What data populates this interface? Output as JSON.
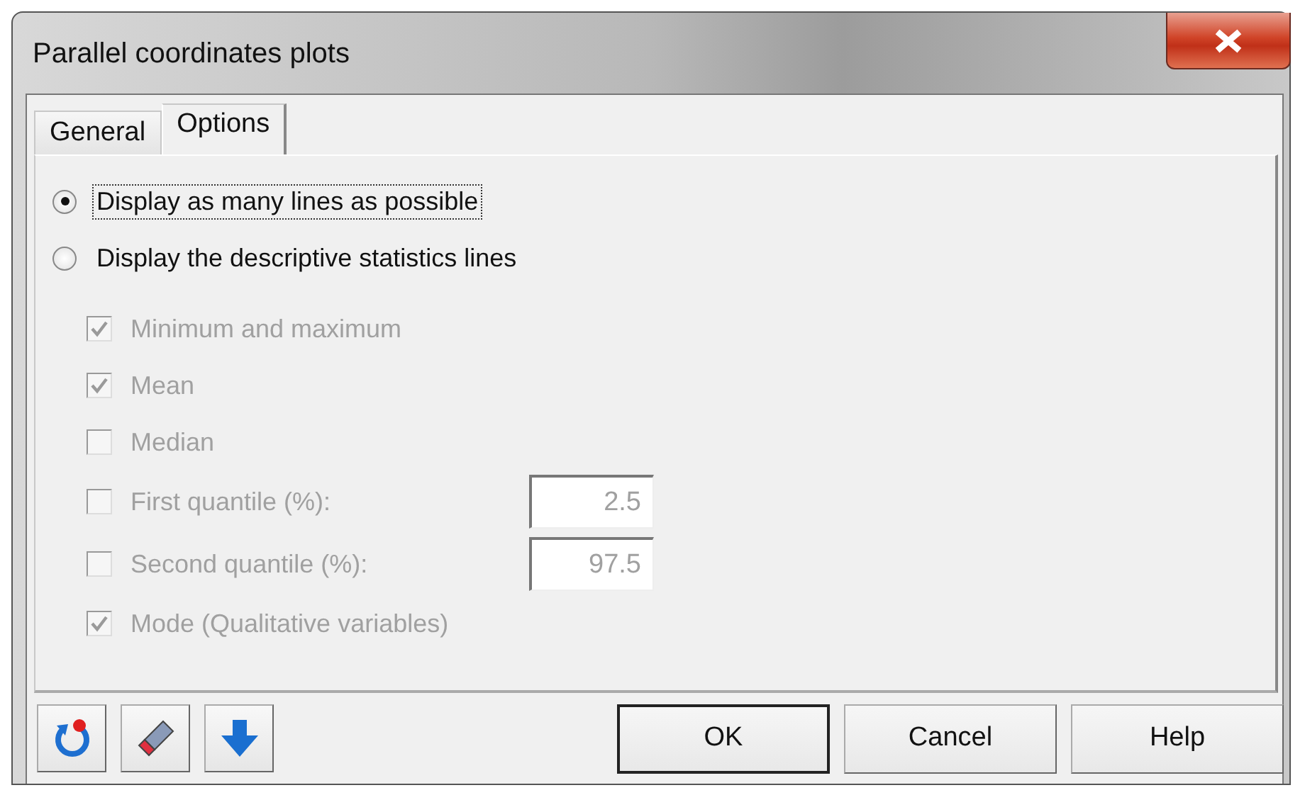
{
  "window": {
    "title": "Parallel coordinates plots"
  },
  "tabs": [
    {
      "label": "General",
      "selected": false
    },
    {
      "label": "Options",
      "selected": true
    }
  ],
  "display_mode": [
    {
      "label": "Display as many lines as possible",
      "selected": true,
      "focused": true
    },
    {
      "label": "Display the descriptive statistics lines",
      "selected": false,
      "focused": false
    }
  ],
  "statistics": [
    {
      "label": "Minimum and maximum",
      "checked": true,
      "disabled": true
    },
    {
      "label": "Mean",
      "checked": true,
      "disabled": true
    },
    {
      "label": "Median",
      "checked": false,
      "disabled": true
    },
    {
      "label": "First quantile (%):",
      "checked": false,
      "disabled": true,
      "value": "2.5"
    },
    {
      "label": "Second quantile (%):",
      "checked": false,
      "disabled": true,
      "value": "97.5"
    },
    {
      "label": "Mode (Qualitative variables)",
      "checked": true,
      "disabled": true
    }
  ],
  "tool_buttons": [
    {
      "kind": "reset"
    },
    {
      "kind": "eraser"
    },
    {
      "kind": "down"
    }
  ],
  "buttons": [
    {
      "label": "OK",
      "default": true
    },
    {
      "label": "Cancel",
      "default": false
    },
    {
      "label": "Help",
      "default": false
    }
  ]
}
